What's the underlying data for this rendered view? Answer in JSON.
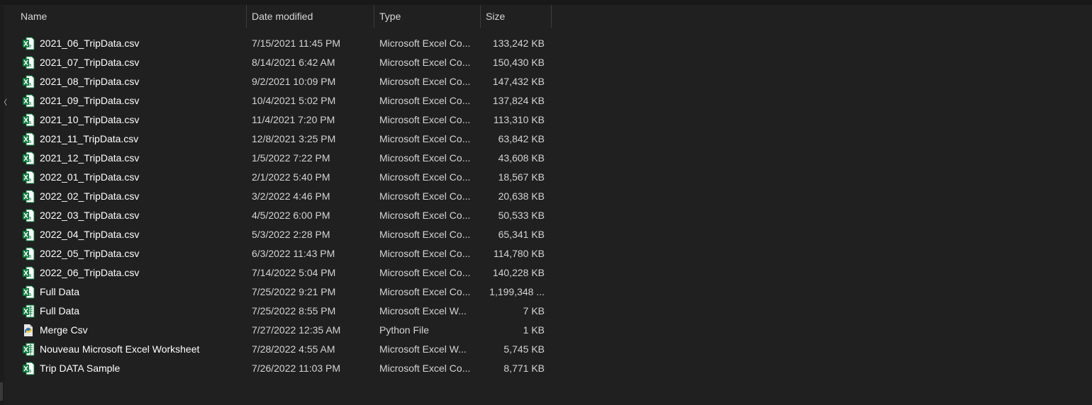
{
  "columns": {
    "name": "Name",
    "date": "Date modified",
    "type": "Type",
    "size": "Size"
  },
  "files": [
    {
      "name": "2021_06_TripData.csv",
      "date": "7/15/2021 11:45 PM",
      "type": "Microsoft Excel Co...",
      "size": "133,242 KB",
      "icon": "excel-csv-icon"
    },
    {
      "name": "2021_07_TripData.csv",
      "date": "8/14/2021 6:42 AM",
      "type": "Microsoft Excel Co...",
      "size": "150,430 KB",
      "icon": "excel-csv-icon"
    },
    {
      "name": "2021_08_TripData.csv",
      "date": "9/2/2021 10:09 PM",
      "type": "Microsoft Excel Co...",
      "size": "147,432 KB",
      "icon": "excel-csv-icon"
    },
    {
      "name": "2021_09_TripData.csv",
      "date": "10/4/2021 5:02 PM",
      "type": "Microsoft Excel Co...",
      "size": "137,824 KB",
      "icon": "excel-csv-icon"
    },
    {
      "name": "2021_10_TripData.csv",
      "date": "11/4/2021 7:20 PM",
      "type": "Microsoft Excel Co...",
      "size": "113,310 KB",
      "icon": "excel-csv-icon"
    },
    {
      "name": "2021_11_TripData.csv",
      "date": "12/8/2021 3:25 PM",
      "type": "Microsoft Excel Co...",
      "size": "63,842 KB",
      "icon": "excel-csv-icon"
    },
    {
      "name": "2021_12_TripData.csv",
      "date": "1/5/2022 7:22 PM",
      "type": "Microsoft Excel Co...",
      "size": "43,608 KB",
      "icon": "excel-csv-icon"
    },
    {
      "name": "2022_01_TripData.csv",
      "date": "2/1/2022 5:40 PM",
      "type": "Microsoft Excel Co...",
      "size": "18,567 KB",
      "icon": "excel-csv-icon"
    },
    {
      "name": "2022_02_TripData.csv",
      "date": "3/2/2022 4:46 PM",
      "type": "Microsoft Excel Co...",
      "size": "20,638 KB",
      "icon": "excel-csv-icon"
    },
    {
      "name": "2022_03_TripData.csv",
      "date": "4/5/2022 6:00 PM",
      "type": "Microsoft Excel Co...",
      "size": "50,533 KB",
      "icon": "excel-csv-icon"
    },
    {
      "name": "2022_04_TripData.csv",
      "date": "5/3/2022 2:28 PM",
      "type": "Microsoft Excel Co...",
      "size": "65,341 KB",
      "icon": "excel-csv-icon"
    },
    {
      "name": "2022_05_TripData.csv",
      "date": "6/3/2022 11:43 PM",
      "type": "Microsoft Excel Co...",
      "size": "114,780 KB",
      "icon": "excel-csv-icon"
    },
    {
      "name": "2022_06_TripData.csv",
      "date": "7/14/2022 5:04 PM",
      "type": "Microsoft Excel Co...",
      "size": "140,228 KB",
      "icon": "excel-csv-icon"
    },
    {
      "name": "Full Data",
      "date": "7/25/2022 9:21 PM",
      "type": "Microsoft Excel Co...",
      "size": "1,199,348 ...",
      "icon": "excel-csv-icon"
    },
    {
      "name": "Full Data",
      "date": "7/25/2022 8:55 PM",
      "type": "Microsoft Excel W...",
      "size": "7 KB",
      "icon": "excel-worksheet-icon"
    },
    {
      "name": "Merge Csv",
      "date": "7/27/2022 12:35 AM",
      "type": "Python File",
      "size": "1 KB",
      "icon": "python-file-icon"
    },
    {
      "name": "Nouveau Microsoft Excel Worksheet",
      "date": "7/28/2022 4:55 AM",
      "type": "Microsoft Excel W...",
      "size": "5,745 KB",
      "icon": "excel-worksheet-icon"
    },
    {
      "name": "Trip DATA Sample",
      "date": "7/26/2022 11:03 PM",
      "type": "Microsoft Excel Co...",
      "size": "8,771 KB",
      "icon": "excel-csv-icon"
    }
  ],
  "colors": {
    "background": "#202020",
    "excel_green": "#107c41",
    "python_blue": "#3a75b0",
    "python_yellow": "#f5cf3f"
  },
  "sort": {
    "column": "Name",
    "direction": "ascending",
    "icon": "sort-up-icon"
  }
}
